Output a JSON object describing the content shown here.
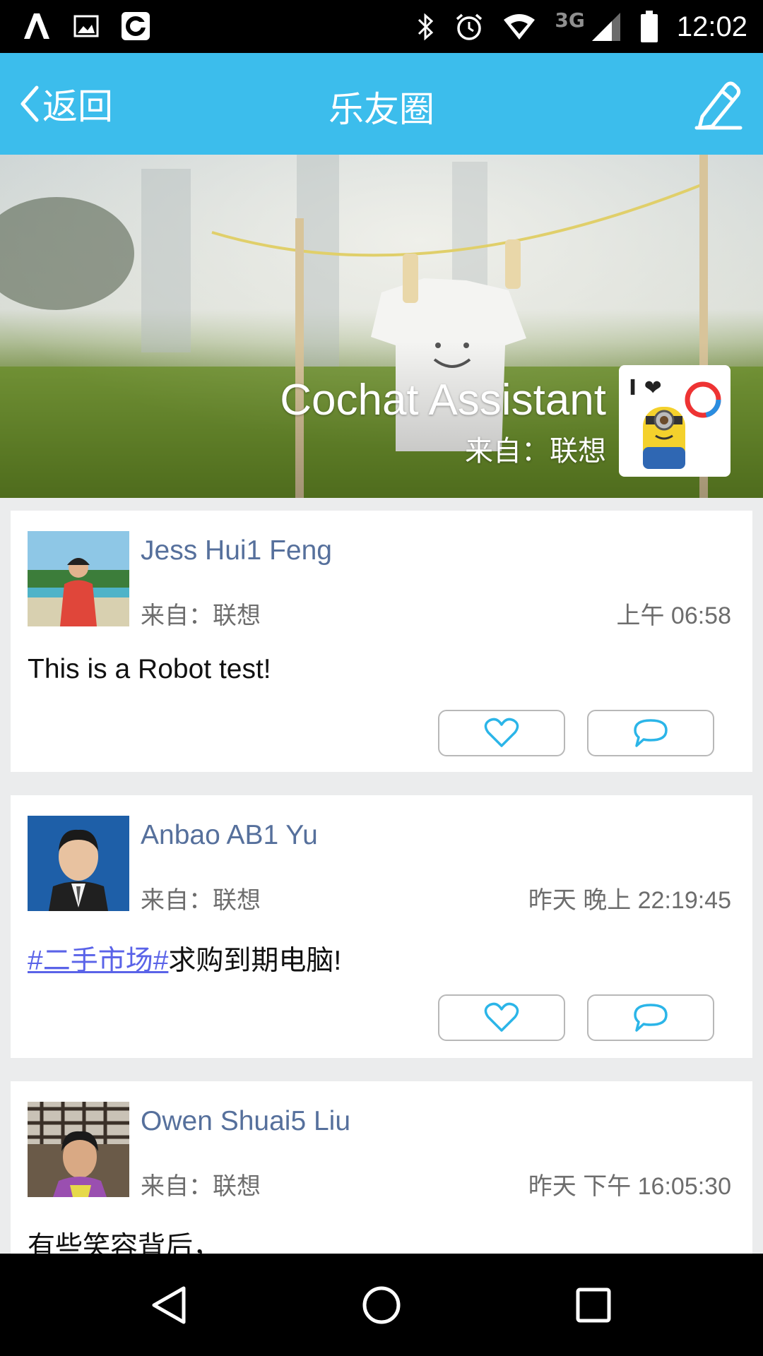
{
  "status_bar": {
    "network": "3G",
    "time": "12:02"
  },
  "header": {
    "back_label": "返回",
    "title": "乐友圈"
  },
  "cover": {
    "name": "Cochat Assistant",
    "from": "来自：联想",
    "avatar_text": "I ❤"
  },
  "posts": [
    {
      "author": "Jess Hui1 Feng",
      "from": "来自：联想",
      "time": "上午 06:58",
      "content": "This is a Robot test!"
    },
    {
      "author": "Anbao AB1 Yu",
      "from": "来自：联想",
      "time": "昨天  晚上 22:19:45",
      "tag": "#二手市场#",
      "content": "求购到期电脑!"
    },
    {
      "author": "Owen Shuai5 Liu",
      "from": "来自：联想",
      "time": "昨天  下午 16:05:30",
      "content": "有些笑容背后，"
    }
  ],
  "colors": {
    "accent": "#3cbdec",
    "author_name": "#56709c",
    "hashtag": "#5a63e8"
  }
}
